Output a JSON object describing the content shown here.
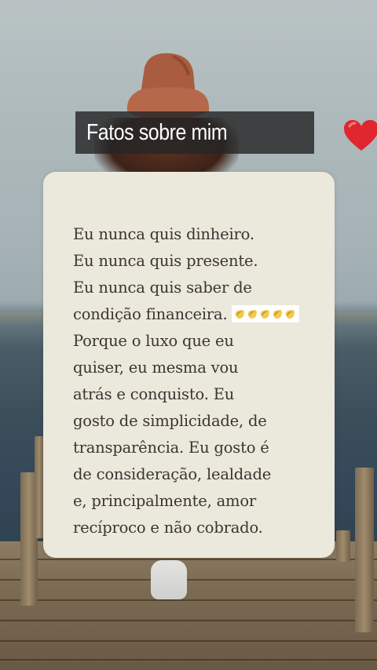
{
  "header": {
    "title": "Fatos sobre mim",
    "title_icon": "red-heart-emoji",
    "bar_color": "#262626",
    "heart_color": "#e0262e"
  },
  "card": {
    "background": "#ebe8dc",
    "text_color": "#3a3531",
    "lines": [
      "Eu nunca quis dinheiro.",
      "Eu nunca quis presente.",
      "Eu nunca quis saber de",
      "condição financeira.",
      "Porque o luxo que eu",
      "quiser, eu mesma vou",
      "atrás e conquisto. Eu",
      "gosto de simplicidade, de",
      "transparência. Eu gosto é",
      "de consideração, lealdade",
      "e, principalmente, amor",
      "recíproco e não cobrado."
    ],
    "inline_emoji": {
      "name": "clapping-hands-emoji",
      "count": 5,
      "after_line": 3
    }
  }
}
